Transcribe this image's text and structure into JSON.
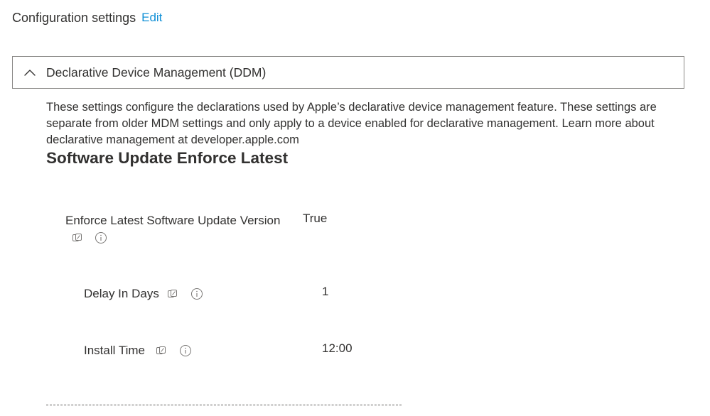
{
  "header": {
    "title": "Configuration settings",
    "edit_label": "Edit"
  },
  "section": {
    "title": "Declarative Device Management (DDM)",
    "expanded": true,
    "description": "These settings configure the declarations used by Apple’s declarative device management feature. These settings are separate from older MDM settings and only apply to a device enabled for declarative management. Learn more about declarative management at developer.apple.com",
    "heading": "Software Update Enforce Latest"
  },
  "settings": [
    {
      "label": "Enforce Latest Software Update Version",
      "value": "True"
    },
    {
      "label": "Delay In Days",
      "value": "1"
    },
    {
      "label": "Install Time",
      "value": "12:00"
    }
  ],
  "icons": {
    "settings_catalog": "settings-catalog-icon",
    "info": "info-icon",
    "collapse": "chevron-up-icon"
  },
  "colors": {
    "link": "#0f8fd6",
    "text": "#323130",
    "border": "#8a8886",
    "icon": "#797775"
  }
}
